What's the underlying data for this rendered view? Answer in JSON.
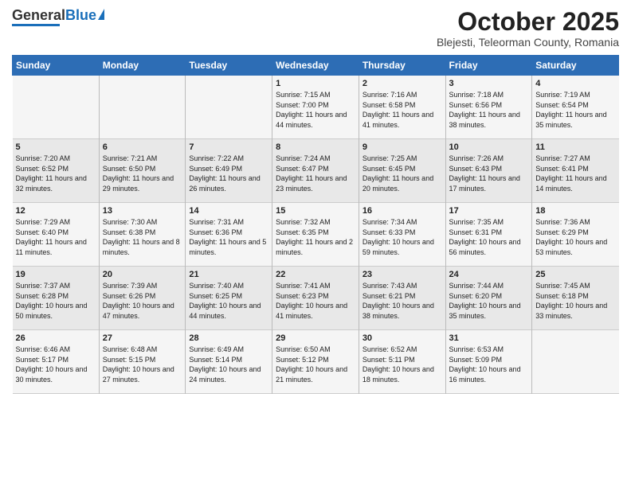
{
  "header": {
    "logo_general": "General",
    "logo_blue": "Blue",
    "main_title": "October 2025",
    "subtitle": "Blejesti, Teleorman County, Romania"
  },
  "days_of_week": [
    "Sunday",
    "Monday",
    "Tuesday",
    "Wednesday",
    "Thursday",
    "Friday",
    "Saturday"
  ],
  "weeks": [
    [
      {
        "day": "",
        "info": ""
      },
      {
        "day": "",
        "info": ""
      },
      {
        "day": "",
        "info": ""
      },
      {
        "day": "1",
        "info": "Sunrise: 7:15 AM\nSunset: 7:00 PM\nDaylight: 11 hours\nand 44 minutes."
      },
      {
        "day": "2",
        "info": "Sunrise: 7:16 AM\nSunset: 6:58 PM\nDaylight: 11 hours\nand 41 minutes."
      },
      {
        "day": "3",
        "info": "Sunrise: 7:18 AM\nSunset: 6:56 PM\nDaylight: 11 hours\nand 38 minutes."
      },
      {
        "day": "4",
        "info": "Sunrise: 7:19 AM\nSunset: 6:54 PM\nDaylight: 11 hours\nand 35 minutes."
      }
    ],
    [
      {
        "day": "5",
        "info": "Sunrise: 7:20 AM\nSunset: 6:52 PM\nDaylight: 11 hours\nand 32 minutes."
      },
      {
        "day": "6",
        "info": "Sunrise: 7:21 AM\nSunset: 6:50 PM\nDaylight: 11 hours\nand 29 minutes."
      },
      {
        "day": "7",
        "info": "Sunrise: 7:22 AM\nSunset: 6:49 PM\nDaylight: 11 hours\nand 26 minutes."
      },
      {
        "day": "8",
        "info": "Sunrise: 7:24 AM\nSunset: 6:47 PM\nDaylight: 11 hours\nand 23 minutes."
      },
      {
        "day": "9",
        "info": "Sunrise: 7:25 AM\nSunset: 6:45 PM\nDaylight: 11 hours\nand 20 minutes."
      },
      {
        "day": "10",
        "info": "Sunrise: 7:26 AM\nSunset: 6:43 PM\nDaylight: 11 hours\nand 17 minutes."
      },
      {
        "day": "11",
        "info": "Sunrise: 7:27 AM\nSunset: 6:41 PM\nDaylight: 11 hours\nand 14 minutes."
      }
    ],
    [
      {
        "day": "12",
        "info": "Sunrise: 7:29 AM\nSunset: 6:40 PM\nDaylight: 11 hours\nand 11 minutes."
      },
      {
        "day": "13",
        "info": "Sunrise: 7:30 AM\nSunset: 6:38 PM\nDaylight: 11 hours\nand 8 minutes."
      },
      {
        "day": "14",
        "info": "Sunrise: 7:31 AM\nSunset: 6:36 PM\nDaylight: 11 hours\nand 5 minutes."
      },
      {
        "day": "15",
        "info": "Sunrise: 7:32 AM\nSunset: 6:35 PM\nDaylight: 11 hours\nand 2 minutes."
      },
      {
        "day": "16",
        "info": "Sunrise: 7:34 AM\nSunset: 6:33 PM\nDaylight: 10 hours\nand 59 minutes."
      },
      {
        "day": "17",
        "info": "Sunrise: 7:35 AM\nSunset: 6:31 PM\nDaylight: 10 hours\nand 56 minutes."
      },
      {
        "day": "18",
        "info": "Sunrise: 7:36 AM\nSunset: 6:29 PM\nDaylight: 10 hours\nand 53 minutes."
      }
    ],
    [
      {
        "day": "19",
        "info": "Sunrise: 7:37 AM\nSunset: 6:28 PM\nDaylight: 10 hours\nand 50 minutes."
      },
      {
        "day": "20",
        "info": "Sunrise: 7:39 AM\nSunset: 6:26 PM\nDaylight: 10 hours\nand 47 minutes."
      },
      {
        "day": "21",
        "info": "Sunrise: 7:40 AM\nSunset: 6:25 PM\nDaylight: 10 hours\nand 44 minutes."
      },
      {
        "day": "22",
        "info": "Sunrise: 7:41 AM\nSunset: 6:23 PM\nDaylight: 10 hours\nand 41 minutes."
      },
      {
        "day": "23",
        "info": "Sunrise: 7:43 AM\nSunset: 6:21 PM\nDaylight: 10 hours\nand 38 minutes."
      },
      {
        "day": "24",
        "info": "Sunrise: 7:44 AM\nSunset: 6:20 PM\nDaylight: 10 hours\nand 35 minutes."
      },
      {
        "day": "25",
        "info": "Sunrise: 7:45 AM\nSunset: 6:18 PM\nDaylight: 10 hours\nand 33 minutes."
      }
    ],
    [
      {
        "day": "26",
        "info": "Sunrise: 6:46 AM\nSunset: 5:17 PM\nDaylight: 10 hours\nand 30 minutes."
      },
      {
        "day": "27",
        "info": "Sunrise: 6:48 AM\nSunset: 5:15 PM\nDaylight: 10 hours\nand 27 minutes."
      },
      {
        "day": "28",
        "info": "Sunrise: 6:49 AM\nSunset: 5:14 PM\nDaylight: 10 hours\nand 24 minutes."
      },
      {
        "day": "29",
        "info": "Sunrise: 6:50 AM\nSunset: 5:12 PM\nDaylight: 10 hours\nand 21 minutes."
      },
      {
        "day": "30",
        "info": "Sunrise: 6:52 AM\nSunset: 5:11 PM\nDaylight: 10 hours\nand 18 minutes."
      },
      {
        "day": "31",
        "info": "Sunrise: 6:53 AM\nSunset: 5:09 PM\nDaylight: 10 hours\nand 16 minutes."
      },
      {
        "day": "",
        "info": ""
      }
    ]
  ]
}
